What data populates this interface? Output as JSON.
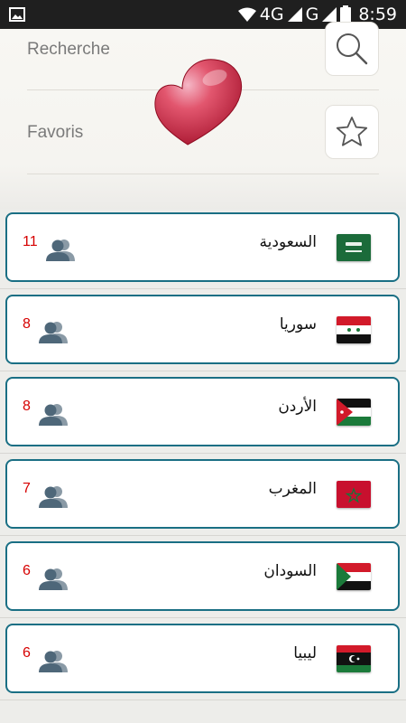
{
  "status_bar": {
    "network": "4G",
    "network2": "G",
    "time": "8:59"
  },
  "menu": {
    "search": {
      "label": "Recherche",
      "icon": "search-icon"
    },
    "favorites": {
      "label": "Favoris",
      "icon": "star-icon"
    }
  },
  "accent_color": "#1a6f84",
  "count_color": "#d60000",
  "rooms": [
    {
      "name": "السعودية",
      "count": "11",
      "flag": "saudi-arabia-flag"
    },
    {
      "name": "سوريا",
      "count": "8",
      "flag": "syria-flag"
    },
    {
      "name": "الأردن",
      "count": "8",
      "flag": "jordan-flag"
    },
    {
      "name": "المغرب",
      "count": "7",
      "flag": "morocco-flag"
    },
    {
      "name": "السودان",
      "count": "6",
      "flag": "sudan-flag"
    },
    {
      "name": "ليبيا",
      "count": "6",
      "flag": "libya-flag"
    }
  ]
}
